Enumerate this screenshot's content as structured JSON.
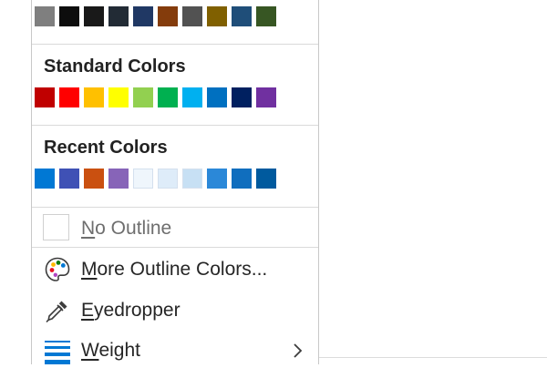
{
  "theme_colors_row": [
    "#7f7f7f",
    "#0d0d0d",
    "#191919",
    "#222b35",
    "#203864",
    "#843c0c",
    "#525252",
    "#806000",
    "#1f4e79",
    "#375623"
  ],
  "standard_colors": {
    "title": "Standard Colors",
    "swatches": [
      "#c00000",
      "#ff0000",
      "#ffc000",
      "#ffff00",
      "#92d050",
      "#00b050",
      "#00b0f0",
      "#0070c0",
      "#002060",
      "#7030a0"
    ]
  },
  "recent_colors": {
    "title": "Recent Colors",
    "swatches": [
      "#0078d4",
      "#3f51b5",
      "#ca5010",
      "#8764b8",
      "#eff6fc",
      "#deecf9",
      "#c7e0f4",
      "#2b88d8",
      "#106ebe",
      "#005a9e"
    ]
  },
  "menu_items": {
    "no_outline": {
      "accel": "N",
      "rest": "o Outline"
    },
    "more_colors": {
      "accel": "M",
      "rest": "ore Outline Colors..."
    },
    "eyedropper": {
      "accel": "E",
      "rest": "yedropper"
    },
    "weight": {
      "accel": "W",
      "rest": "eight"
    }
  },
  "icons": {
    "more_colors": "palette-icon",
    "eyedropper": "eyedropper-icon",
    "weight": "line-weight-icon",
    "submenu": "chevron-right-icon"
  }
}
